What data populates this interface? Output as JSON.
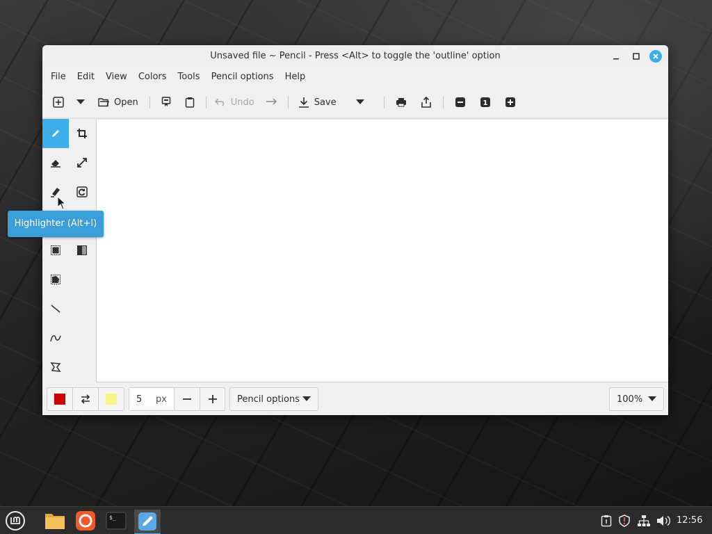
{
  "window": {
    "title": "Unsaved file ~ Pencil - Press <Alt> to toggle the 'outline' option",
    "accent_color": "#3daee9"
  },
  "menubar": {
    "items": [
      "File",
      "Edit",
      "View",
      "Colors",
      "Tools",
      "Pencil options",
      "Help"
    ]
  },
  "toolbar": {
    "new_icon": "new-image-icon",
    "open_label": "Open",
    "undo_label": "Undo",
    "save_label": "Save",
    "zoom_reset_label": "1"
  },
  "side_tools": [
    {
      "name": "pencil",
      "icon": "pencil-icon",
      "active": true
    },
    {
      "name": "crop",
      "icon": "crop-icon"
    },
    {
      "name": "eraser",
      "icon": "eraser-icon"
    },
    {
      "name": "scale",
      "icon": "scale-icon"
    },
    {
      "name": "highlighter",
      "icon": "highlighter-icon"
    },
    {
      "name": "rotate",
      "icon": "rotate-icon"
    },
    {
      "name": "rectangle-select",
      "icon": "rect-select-icon"
    },
    {
      "name": "filters",
      "icon": "filters-icon"
    },
    {
      "name": "free-select",
      "icon": "free-select-icon"
    },
    {
      "name": "line",
      "icon": "line-icon"
    },
    {
      "name": "curve",
      "icon": "curve-icon"
    },
    {
      "name": "shape",
      "icon": "shape-icon"
    }
  ],
  "tooltip": {
    "text": "Highlighter (Alt+I)"
  },
  "bottombar": {
    "left_color": "#cc0000",
    "right_color": "#f5f58a",
    "size_value": "5",
    "size_unit": "px",
    "options_label": "Pencil options",
    "zoom_label": "100%"
  },
  "taskbar": {
    "clock": "12:56",
    "apps": [
      "menu-icon",
      "files-icon",
      "firefox-icon",
      "terminal-icon",
      "drawing-icon"
    ]
  }
}
